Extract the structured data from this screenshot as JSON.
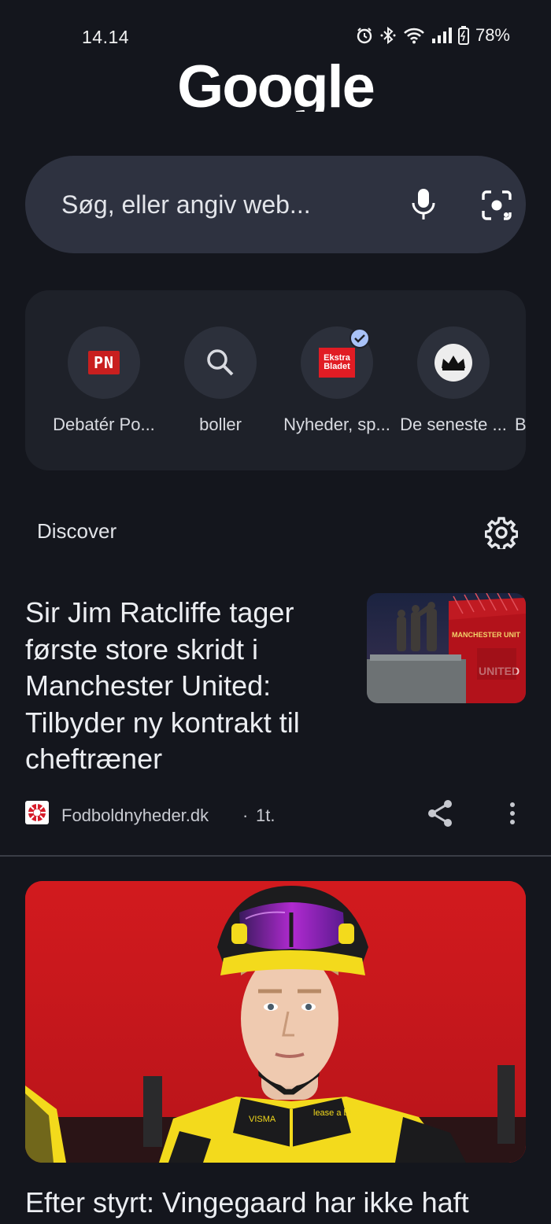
{
  "status_bar": {
    "time": "14.14",
    "battery": "78%",
    "icons": [
      "alarm-icon",
      "bluetooth-icon",
      "wifi-icon",
      "signal-icon",
      "battery-icon"
    ]
  },
  "logo": {
    "text": "Google"
  },
  "search": {
    "placeholder": "Søg, eller angiv web...",
    "icons": [
      "mic-icon",
      "lens-icon"
    ]
  },
  "shortcuts": [
    {
      "label": "Debatér Po...",
      "icon": "pn-logo",
      "icon_text": "PN"
    },
    {
      "label": "boller",
      "icon": "search-icon"
    },
    {
      "label": "Nyheder, sp...",
      "icon": "ekstra-bladet-logo",
      "icon_text": "Ekstra Bladet",
      "verified": true
    },
    {
      "label": "De seneste ...",
      "icon": "crown-logo"
    },
    {
      "label": "B",
      "icon": ""
    }
  ],
  "discover": {
    "title": "Discover",
    "settings_icon": "gear-icon"
  },
  "articles": [
    {
      "headline": "Sir Jim Ratcliffe tager første store skridt i Manchester United: Tilbyder ny kontrakt til cheftræner",
      "source": "Fodboldnyheder.dk",
      "separator": "·",
      "time": "1t.",
      "thumbnail_text": [
        "MANCHESTER UNIT",
        "UNITED"
      ]
    },
    {
      "headline": "Efter styrt: Vingegaard har ikke haft",
      "hero_texts": [
        "VISMA",
        "lease a bike"
      ]
    }
  ],
  "colors": {
    "background": "#14161d",
    "search_bar": "#2e3240",
    "panel": "#1e2129",
    "hero_red": "#c8161a",
    "jersey_yellow": "#f3da1c"
  }
}
